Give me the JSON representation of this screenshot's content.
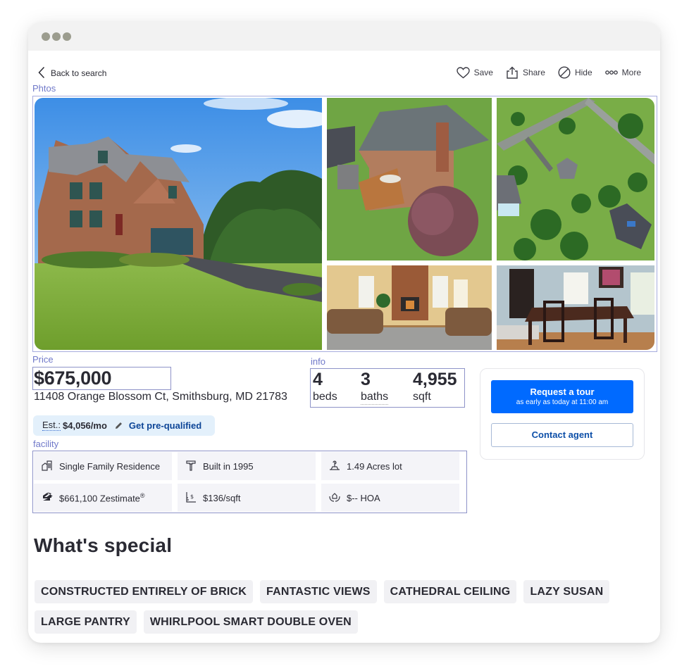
{
  "window": {
    "controls": [
      "dot",
      "dot",
      "dot"
    ]
  },
  "nav": {
    "back_label": "Back to search",
    "actions": [
      {
        "icon": "heart-icon",
        "label": "Save"
      },
      {
        "icon": "share-icon",
        "label": "Share"
      },
      {
        "icon": "hide-icon",
        "label": "Hide"
      },
      {
        "icon": "more-icon",
        "label": "More"
      }
    ]
  },
  "sections": {
    "photos_label": "Phtos",
    "price_label": "Price",
    "info_label": "info",
    "facility_label": "facility"
  },
  "photos": [
    {
      "subject": "Front exterior of brick colonial house with lawn and driveway"
    },
    {
      "subject": "Aerial rear view of house with deck"
    },
    {
      "subject": "Aerial overhead view of lot and neighborhood"
    },
    {
      "subject": "Living room with brick fireplace and sofas"
    },
    {
      "subject": "Dining room with wooden table and chairs"
    }
  ],
  "listing": {
    "price": "$675,000",
    "address": "11408 Orange Blossom Ct, Smithsburg, MD 21783",
    "estimate": {
      "label": "Est.:",
      "amount": "$4,056/mo",
      "icon": "pencil-icon",
      "link": "Get pre-qualified"
    }
  },
  "info": {
    "beds": {
      "value": "4",
      "unit": "beds"
    },
    "baths": {
      "value": "3",
      "unit": "baths"
    },
    "sqft": {
      "value": "4,955",
      "unit": "sqft"
    }
  },
  "tour": {
    "request_title": "Request a tour",
    "request_subtitle": "as early as today at 11:00 am",
    "contact_label": "Contact agent"
  },
  "facts": [
    {
      "icon": "home-type-icon",
      "text": "Single Family Residence"
    },
    {
      "icon": "hammer-icon",
      "text": "Built in 1995"
    },
    {
      "icon": "lot-icon",
      "text": "1.49 Acres lot"
    },
    {
      "icon": "zestimate-icon",
      "text": "$661,100 Zestimate",
      "sup": "®"
    },
    {
      "icon": "price-per-sqft-icon",
      "text": "$136/sqft"
    },
    {
      "icon": "hoa-icon",
      "text": "$-- HOA"
    }
  ],
  "special": {
    "title": "What's special",
    "tags": [
      "CONSTRUCTED ENTIRELY OF BRICK",
      "FANTASTIC VIEWS",
      "CATHEDRAL CEILING",
      "LAZY SUSAN",
      "LARGE PANTRY",
      "WHIRLPOOL SMART DOUBLE OVEN"
    ]
  },
  "colors": {
    "primary_button": "#006aff",
    "link": "#0d4597",
    "annotation": "#7079c9",
    "estimate_bg": "#e3f0fb",
    "tag_bg": "#f1f1f4"
  }
}
